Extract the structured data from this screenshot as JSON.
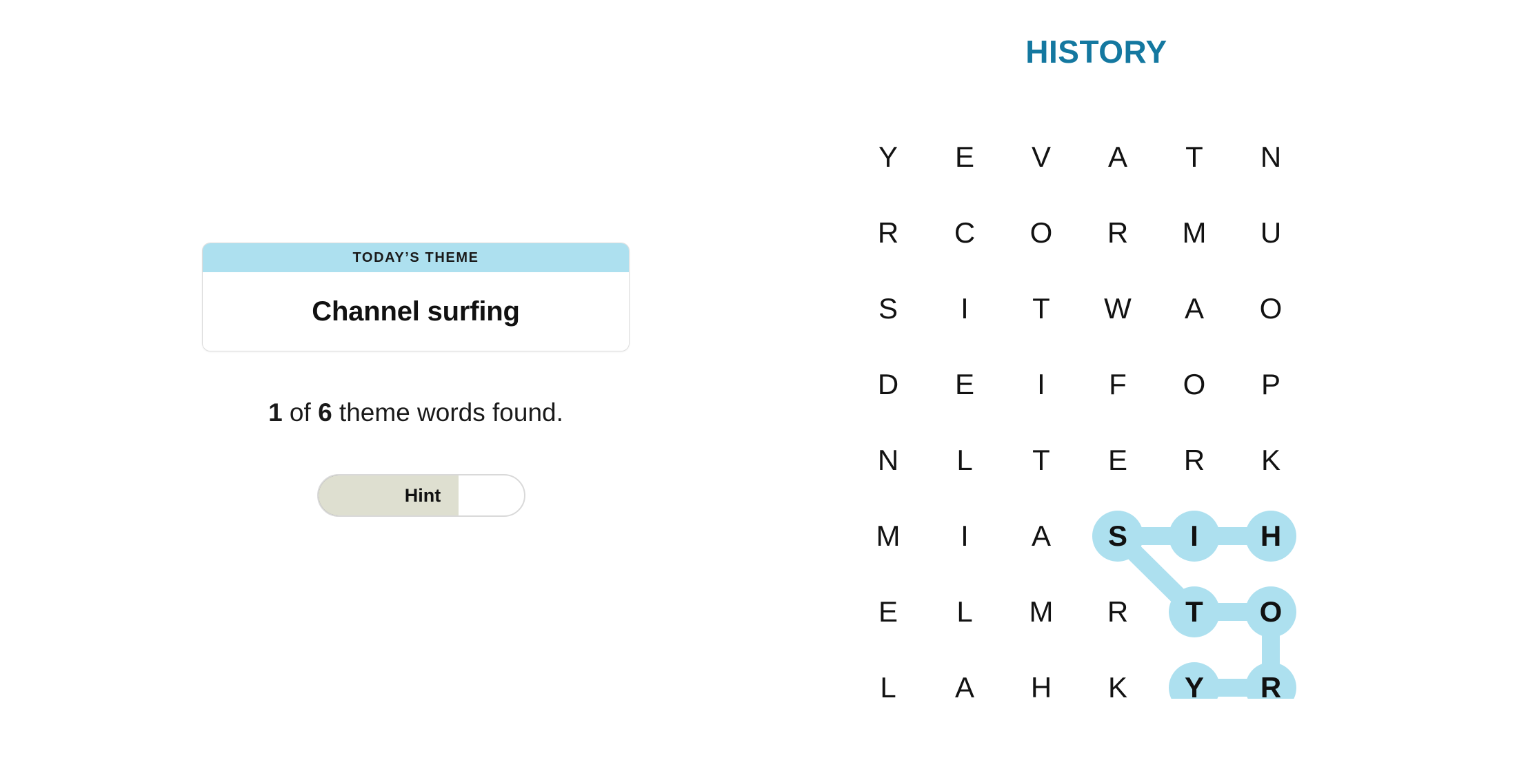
{
  "puzzle": {
    "title": "HISTORY",
    "title_color": "#1478a0",
    "highlight_color": "#ade0ef"
  },
  "theme_card": {
    "label": "TODAY’S THEME",
    "title": "Channel surfing",
    "header_color": "#ade0ef"
  },
  "progress": {
    "found_count": "1",
    "prefix": " of ",
    "total_count": "6",
    "suffix": " theme words found."
  },
  "hint_button": {
    "label": "Hint",
    "fill_percent": 68,
    "fill_color": "#dedfd0"
  },
  "grid": {
    "rows": 8,
    "cols": 6,
    "letters": [
      [
        "Y",
        "E",
        "V",
        "A",
        "T",
        "N"
      ],
      [
        "R",
        "C",
        "O",
        "R",
        "M",
        "U"
      ],
      [
        "S",
        "I",
        "T",
        "W",
        "A",
        "O"
      ],
      [
        "D",
        "E",
        "I",
        "F",
        "O",
        "P"
      ],
      [
        "N",
        "L",
        "T",
        "E",
        "R",
        "K"
      ],
      [
        "M",
        "I",
        "A",
        "S",
        "I",
        "H"
      ],
      [
        "E",
        "L",
        "M",
        "R",
        "T",
        "O"
      ],
      [
        "L",
        "A",
        "H",
        "K",
        "Y",
        "R"
      ]
    ],
    "found_words": [
      {
        "word": "HISTORY",
        "path": [
          {
            "row": 5,
            "col": 5,
            "letter": "H"
          },
          {
            "row": 5,
            "col": 4,
            "letter": "I"
          },
          {
            "row": 5,
            "col": 3,
            "letter": "S"
          },
          {
            "row": 6,
            "col": 4,
            "letter": "T"
          },
          {
            "row": 6,
            "col": 5,
            "letter": "O"
          },
          {
            "row": 7,
            "col": 5,
            "letter": "R"
          },
          {
            "row": 7,
            "col": 4,
            "letter": "Y"
          }
        ]
      }
    ]
  }
}
